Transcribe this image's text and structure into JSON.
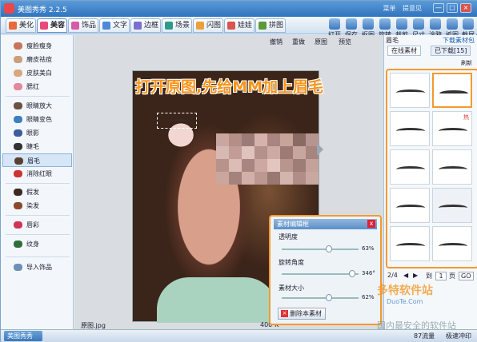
{
  "window": {
    "title": "美图秀秀 2.2.5",
    "user_links": [
      "菜单",
      "提意见"
    ],
    "controls": [
      "—",
      "□",
      "×"
    ]
  },
  "tabs": [
    {
      "label": "美化",
      "color": "#e96a3a"
    },
    {
      "label": "美容",
      "color": "#e8497c",
      "active": true
    },
    {
      "label": "饰品",
      "color": "#d65aa8"
    },
    {
      "label": "文字",
      "color": "#4c8ad6"
    },
    {
      "label": "边框",
      "color": "#7a6fd0"
    },
    {
      "label": "场景",
      "color": "#2e9a8a"
    },
    {
      "label": "闪图",
      "color": "#e9a23a"
    },
    {
      "label": "娃娃",
      "color": "#d9534f"
    },
    {
      "label": "拼图",
      "color": "#5a9a3a"
    }
  ],
  "top_tools": [
    "打开",
    "保存",
    "抠图",
    "旋转",
    "裁剪",
    "尺寸",
    "涂鸦",
    "抓图",
    "截屏"
  ],
  "sidebar": {
    "items": [
      {
        "label": "瘦脸瘦身",
        "color": "#c9735a"
      },
      {
        "label": "磨皮祛痘",
        "color": "#caa07a"
      },
      {
        "label": "皮肤美白",
        "color": "#d9a77e"
      },
      {
        "label": "腮红",
        "color": "#e7879b"
      },
      {
        "label": "眼睛放大",
        "color": "#6a5143"
      },
      {
        "label": "眼睛变色",
        "color": "#3d7fc0"
      },
      {
        "label": "眼影",
        "color": "#3a5ba0"
      },
      {
        "label": "睫毛",
        "color": "#333333"
      },
      {
        "label": "眉毛",
        "color": "#5a4030",
        "active": true
      },
      {
        "label": "消除红眼",
        "color": "#cc3333"
      },
      {
        "label": "假发",
        "color": "#3b2a20"
      },
      {
        "label": "染发",
        "color": "#8a4a2a"
      },
      {
        "label": "唇彩",
        "color": "#d03355"
      },
      {
        "label": "纹身",
        "color": "#2f6e3a"
      },
      {
        "label": "导入饰品",
        "color": "#6d8fb5"
      }
    ]
  },
  "canvas": {
    "tools": [
      "撤销",
      "重做",
      "原图",
      "预览"
    ],
    "headline": "打开原图,先给MM加上眉毛",
    "filename": "原图.jpg",
    "size": "400",
    "size_unit": "K"
  },
  "panel": {
    "title": "素材编辑框",
    "close": "x",
    "rows": [
      {
        "label": "透明度",
        "value": "63%",
        "fraction": 0.63
      },
      {
        "label": "旋转角度",
        "value": "346°",
        "fraction": 0.96
      },
      {
        "label": "素材大小",
        "value": "62%",
        "fraction": 0.62
      }
    ],
    "delete_label": "删除本素材"
  },
  "right_panel": {
    "title": "眉毛",
    "download_link": "下载素材包",
    "tabs": [
      "在线素材",
      "已下载[15]"
    ],
    "refresh": "刷新",
    "hot": "热",
    "page_current": "2/4",
    "goto_label": "到",
    "page_input": "1",
    "page_unit": "页",
    "go": "GO"
  },
  "status": {
    "left": "美图秀秀",
    "right": [
      "87流量",
      "极速冲印"
    ]
  },
  "watermark": {
    "line1": "多特软件站",
    "line2": "DuoTe.Com",
    "line3": "国内最安全的软件站"
  }
}
